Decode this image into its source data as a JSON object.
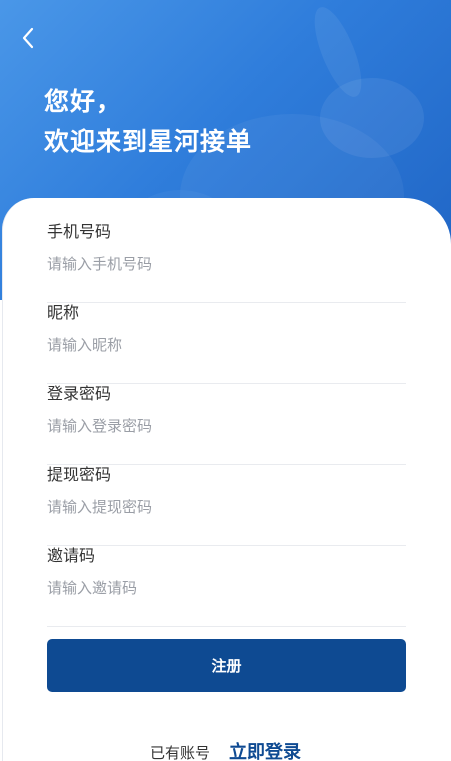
{
  "hero": {
    "greeting_line1": "您好，",
    "greeting_line2": "欢迎来到星河接单",
    "back_icon": "chevron-left-icon",
    "gradient_start": "#4a97e8",
    "gradient_end": "#1f64c4"
  },
  "form": {
    "fields": [
      {
        "label": "手机号码",
        "placeholder": "请输入手机号码",
        "value": ""
      },
      {
        "label": "昵称",
        "placeholder": "请输入昵称",
        "value": ""
      },
      {
        "label": "登录密码",
        "placeholder": "请输入登录密码",
        "value": ""
      },
      {
        "label": "提现密码",
        "placeholder": "请输入提现密码",
        "value": ""
      },
      {
        "label": "邀请码",
        "placeholder": "请输入邀请码",
        "value": ""
      }
    ],
    "submit_label": "注册"
  },
  "footer": {
    "have_account": "已有账号",
    "login_link": "立即登录"
  },
  "colors": {
    "primary": "#0e4a92",
    "divider": "#e9ebef",
    "placeholder": "#9a9ea6"
  }
}
